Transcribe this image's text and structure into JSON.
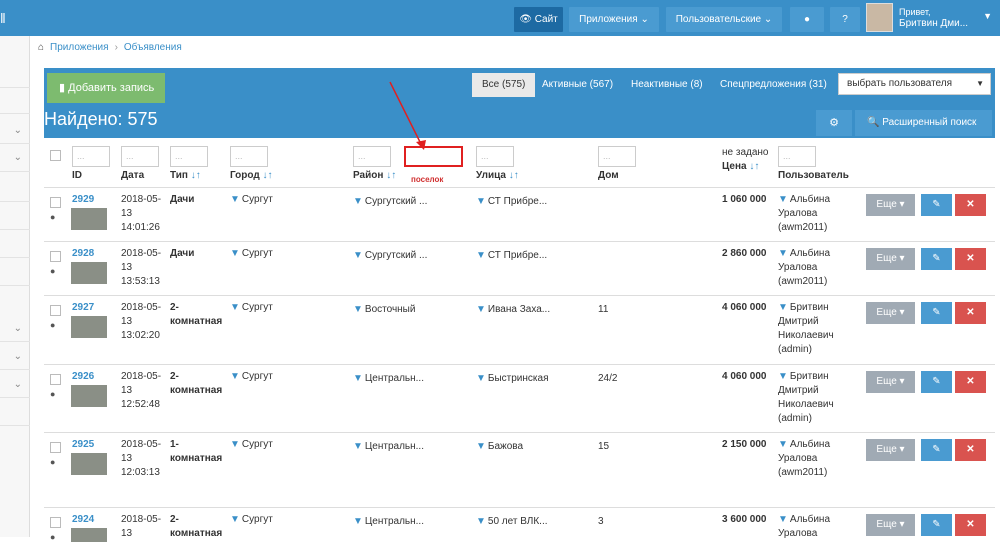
{
  "topbar": {
    "site_label": "Сайт",
    "apps_label": "Приложения",
    "users_label": "Пользовательские",
    "greeting": "Привет,",
    "user_name": "Бритвин Дми..."
  },
  "breadcrumb": {
    "item1": "Приложения",
    "item2": "Объявления"
  },
  "toolbar": {
    "add_label": "Добавить запись",
    "found_label": "Найдено: 575",
    "tabs": [
      {
        "label": "Все (575)"
      },
      {
        "label": "Активные (567)"
      },
      {
        "label": "Неактивные (8)"
      },
      {
        "label": "Спецпредложения (31)"
      }
    ],
    "user_select": "выбрать пользователя",
    "advanced_search": "Расширенный поиск"
  },
  "columns": {
    "id": "ID",
    "date": "Дата",
    "type": "Тип",
    "city": "Город",
    "district": "Район",
    "street": "Улица",
    "house": "Дом",
    "price_note": "не задано",
    "price": "Цена",
    "user": "Пользователь",
    "annotation": "поселок",
    "filter_placeholder": "..."
  },
  "row_actions": {
    "more_label": "Еще"
  },
  "rows": [
    {
      "id": "2929",
      "date1": "2018-05-",
      "date2": "13",
      "time": "14:01:26",
      "type1": "Дачи",
      "type2": "",
      "city": "Сургут",
      "district": "Сургутский ...",
      "street": "СТ Прибре...",
      "house": "",
      "price": "1 060 000",
      "user1": "Альбина",
      "user2": "Уралова",
      "user3": "(awm2011)",
      "user4": ""
    },
    {
      "id": "2928",
      "date1": "2018-05-",
      "date2": "13",
      "time": "13:53:13",
      "type1": "Дачи",
      "type2": "",
      "city": "Сургут",
      "district": "Сургутский ...",
      "street": "СТ Прибре...",
      "house": "",
      "price": "2 860 000",
      "user1": "Альбина",
      "user2": "Уралова",
      "user3": "(awm2011)",
      "user4": ""
    },
    {
      "id": "2927",
      "date1": "2018-05-",
      "date2": "13",
      "time": "13:02:20",
      "type1": "2-",
      "type2": "комнатная",
      "city": "Сургут",
      "district": "Восточный",
      "street": "Ивана Заха...",
      "house": "11",
      "price": "4 060 000",
      "user1": "Бритвин",
      "user2": "Дмитрий",
      "user3": "Николаевич",
      "user4": "(admin)"
    },
    {
      "id": "2926",
      "date1": "2018-05-",
      "date2": "13",
      "time": "12:52:48",
      "type1": "2-",
      "type2": "комнатная",
      "city": "Сургут",
      "district": "Центральн...",
      "street": "Быстринская",
      "house": "24/2",
      "price": "4 060 000",
      "user1": "Бритвин",
      "user2": "Дмитрий",
      "user3": "Николаевич",
      "user4": "(admin)"
    },
    {
      "id": "2925",
      "date1": "2018-05-",
      "date2": "13",
      "time": "12:03:13",
      "type1": "1-",
      "type2": "комнатная",
      "city": "Сургут",
      "district": "Центральн...",
      "street": "Бажова",
      "house": "15",
      "price": "2 150 000",
      "user1": "Альбина",
      "user2": "Уралова",
      "user3": "(awm2011)",
      "user4": ""
    },
    {
      "id": "2924",
      "date1": "2018-05-",
      "date2": "13",
      "time": "",
      "type1": "2-",
      "type2": "комнатная",
      "city": "Сургут",
      "district": "Центральн...",
      "street": "50 лет ВЛК...",
      "house": "3",
      "price": "3 600 000",
      "user1": "Альбина",
      "user2": "Уралова",
      "user3": "",
      "user4": ""
    }
  ]
}
